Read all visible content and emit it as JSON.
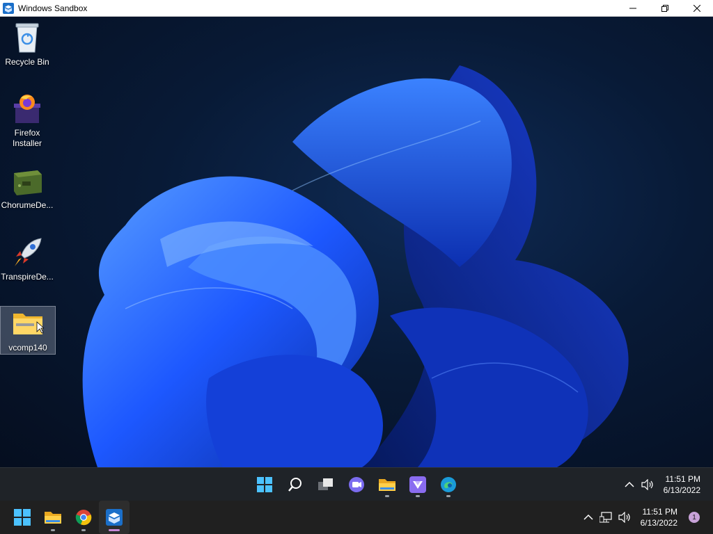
{
  "window": {
    "title": "Windows Sandbox"
  },
  "desktop_icons": [
    {
      "label": "Recycle Bin",
      "icon": "recycle-bin-icon"
    },
    {
      "label": "Firefox Installer",
      "icon": "firefox-installer-icon"
    },
    {
      "label": "ChorumeDe...",
      "icon": "chorume-icon"
    },
    {
      "label": "TranspireDe...",
      "icon": "rocket-icon"
    },
    {
      "label": "vcomp140",
      "icon": "zip-folder-icon",
      "selected": true
    }
  ],
  "inner_taskbar": {
    "apps": [
      "start-icon",
      "search-icon",
      "task-view-icon",
      "chat-icon",
      "file-explorer-icon",
      "sandbox-app-icon",
      "edge-icon"
    ],
    "clock": {
      "time": "11:51 PM",
      "date": "6/13/2022"
    }
  },
  "host_taskbar": {
    "apps": [
      "start-icon",
      "file-explorer-icon",
      "chrome-icon",
      "windows-sandbox-icon"
    ],
    "clock": {
      "time": "11:51 PM",
      "date": "6/13/2022"
    },
    "notification_count": "1"
  },
  "colors": {
    "accent": "#0078d4",
    "bloom": "#1e5bff",
    "taskbar": "#202020"
  }
}
